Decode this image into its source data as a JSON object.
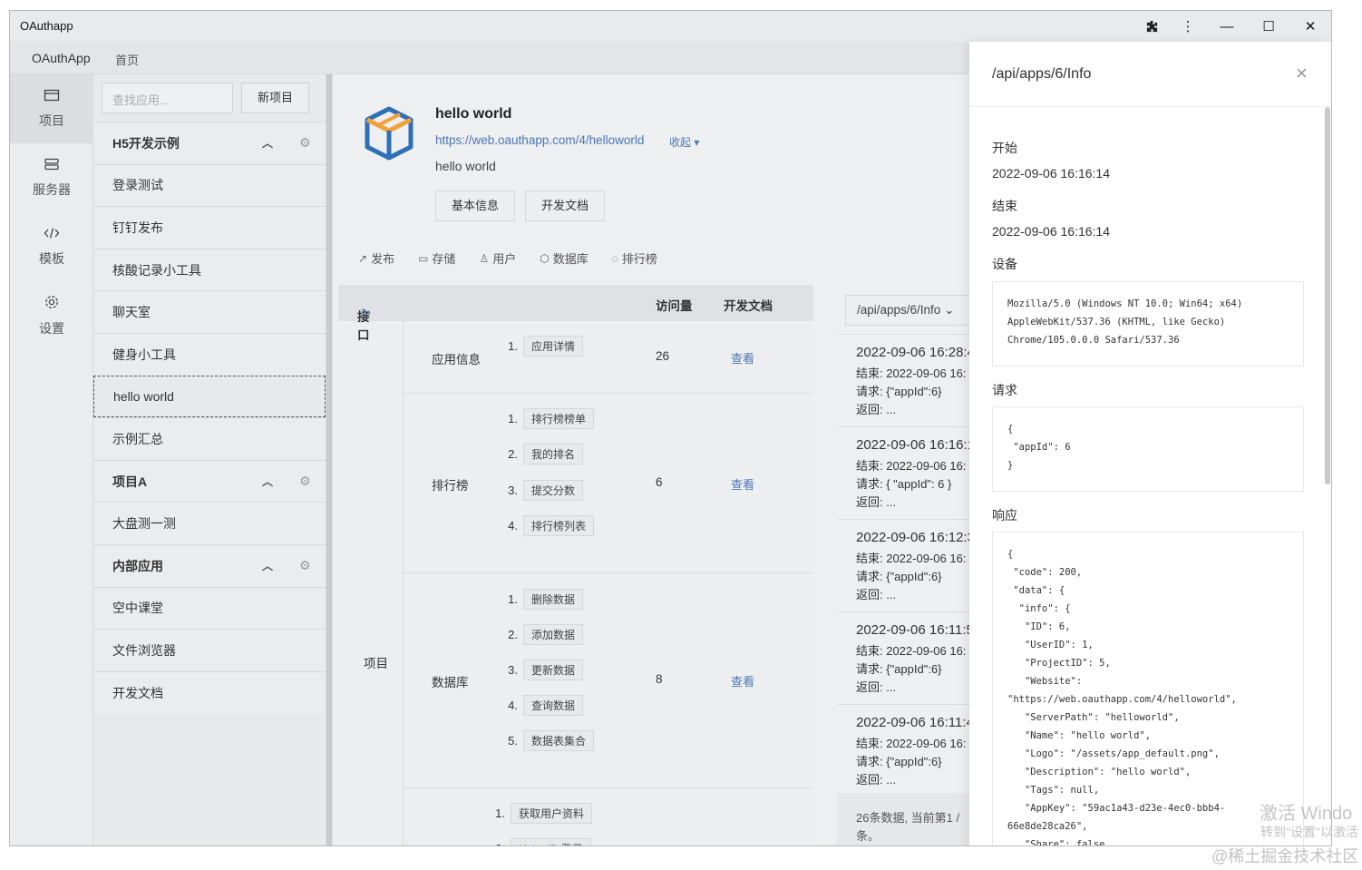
{
  "window": {
    "title": "OAuthapp",
    "controls": {
      "extensions": "puzzle-icon",
      "menu": "⋮",
      "minimize": "—",
      "maximize": "☐",
      "close": "✕"
    }
  },
  "nav": {
    "brand": "OAuthApp",
    "home": "首页"
  },
  "sidebar": {
    "items": [
      {
        "label": "项目",
        "icon": "folder-icon"
      },
      {
        "label": "服务器",
        "icon": "server-icon"
      },
      {
        "label": "模板",
        "icon": "code-icon"
      },
      {
        "label": "设置",
        "icon": "gear-icon"
      }
    ]
  },
  "apps": {
    "search_placeholder": "查找应用...",
    "new_button": "新项目",
    "groups": [
      {
        "name": "H5开发示例",
        "items": [
          "登录测试",
          "钉钉发布",
          "核酸记录小工具",
          "聊天室",
          "健身小工具",
          "hello world",
          "示例汇总"
        ]
      },
      {
        "name": "项目A",
        "items": [
          "大盘测一测"
        ]
      },
      {
        "name": "内部应用",
        "items": [
          "空中课堂",
          "文件浏览器",
          "开发文档"
        ]
      }
    ],
    "selected": "hello world"
  },
  "app": {
    "name": "hello world",
    "url": "https://web.oauthapp.com/4/helloworld",
    "collapse": "收起",
    "description": "hello world",
    "buttons": {
      "info": "基本信息",
      "docs": "开发文档"
    },
    "tabs": [
      "发布",
      "存储",
      "用户",
      "数据库",
      "排行榜"
    ]
  },
  "api_table": {
    "headers": {
      "api": "接口",
      "visits": "访问量",
      "docs": "开发文档"
    },
    "project_label": "项目",
    "view_label": "查看",
    "groups": [
      {
        "name": "应用信息",
        "count": "26",
        "endpoints": [
          "应用详情"
        ]
      },
      {
        "name": "排行榜",
        "count": "6",
        "endpoints": [
          "排行榜榜单",
          "我的排名",
          "提交分数",
          "排行榜列表"
        ]
      },
      {
        "name": "数据库",
        "count": "8",
        "endpoints": [
          "删除数据",
          "添加数据",
          "更新数据",
          "查询数据",
          "数据表集合"
        ]
      },
      {
        "name": "",
        "count": "",
        "endpoints": [
          "获取用户资料",
          "UnionID 登录"
        ]
      }
    ]
  },
  "logs": {
    "selected_api": "/api/apps/6/Info",
    "entries": [
      {
        "time": "2022-09-06 16:28:4",
        "end": "结束: 2022-09-06 16:",
        "req": "请求: {\"appId\":6}",
        "ret": "返回: ..."
      },
      {
        "time": "2022-09-06 16:16:1",
        "end": "结束: 2022-09-06 16:",
        "req": "请求: { \"appId\": 6 }",
        "ret": "返回: ..."
      },
      {
        "time": "2022-09-06 16:12:3",
        "end": "结束: 2022-09-06 16:",
        "req": "请求: {\"appId\":6}",
        "ret": "返回: ..."
      },
      {
        "time": "2022-09-06 16:11:5",
        "end": "结束: 2022-09-06 16:",
        "req": "请求: {\"appId\":6}",
        "ret": "返回: ..."
      },
      {
        "time": "2022-09-06 16:11:4",
        "end": "结束: 2022-09-06 16:",
        "req": "请求: {\"appId\":6}",
        "ret": "返回: ..."
      }
    ],
    "footer_line1": "26条数据, 当前第1 /",
    "footer_line2": "条。"
  },
  "drawer": {
    "title": "/api/apps/6/Info",
    "start_label": "开始",
    "start_value": "2022-09-06 16:16:14",
    "end_label": "结束",
    "end_value": "2022-09-06 16:16:14",
    "device_label": "设备",
    "device_value": "Mozilla/5.0 (Windows NT 10.0; Win64; x64)\nAppleWebKit/537.36 (KHTML, like Gecko)\nChrome/105.0.0.0 Safari/537.36",
    "request_label": "请求",
    "request_value": "{\n \"appId\": 6\n}",
    "response_label": "响应",
    "response_value": "{\n \"code\": 200,\n \"data\": {\n  \"info\": {\n   \"ID\": 6,\n   \"UserID\": 1,\n   \"ProjectID\": 5,\n   \"Website\":\n\"https://web.oauthapp.com/4/helloworld\",\n   \"ServerPath\": \"helloworld\",\n   \"Name\": \"hello world\",\n   \"Logo\": \"/assets/app_default.png\",\n   \"Description\": \"hello world\",\n   \"Tags\": null,\n   \"AppKey\": \"59ac1a43-d23e-4ec0-bbb4-\n66e8de28ca26\",\n   \"Share\": false,"
  },
  "overlay": {
    "activate_line1": "激活 Windo",
    "activate_line2": "转到\"设置\"以激活",
    "watermark": "@稀土掘金技术社区"
  }
}
